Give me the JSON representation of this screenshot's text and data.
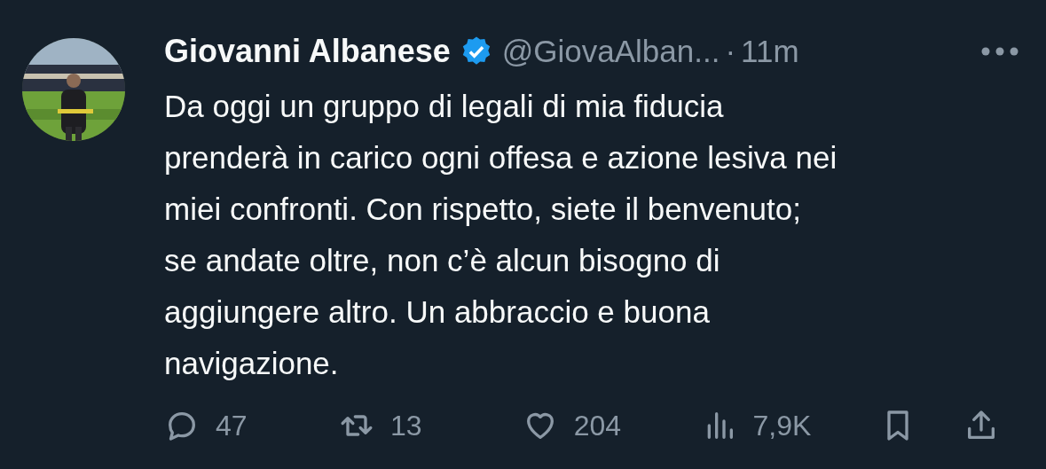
{
  "post": {
    "author": "Giovanni Albanese",
    "verified": true,
    "handle": "@GiovaAlban...",
    "separator": "·",
    "time": "11m",
    "text_lines": [
      "Da oggi un gruppo di legali di mia fiducia",
      "prenderà in carico ogni offesa e azione lesiva nei",
      "miei confronti. Con rispetto, siete il benvenuto;",
      "se andate oltre, non c’è alcun bisogno di",
      "aggiungere altro. Un abbraccio e buona",
      "navigazione."
    ],
    "actions": [
      {
        "kind": "reply",
        "count": "47"
      },
      {
        "kind": "repost",
        "count": "13"
      },
      {
        "kind": "like",
        "count": "204"
      },
      {
        "kind": "views",
        "count": "7,9K"
      },
      {
        "kind": "bookmark"
      },
      {
        "kind": "share"
      }
    ]
  }
}
